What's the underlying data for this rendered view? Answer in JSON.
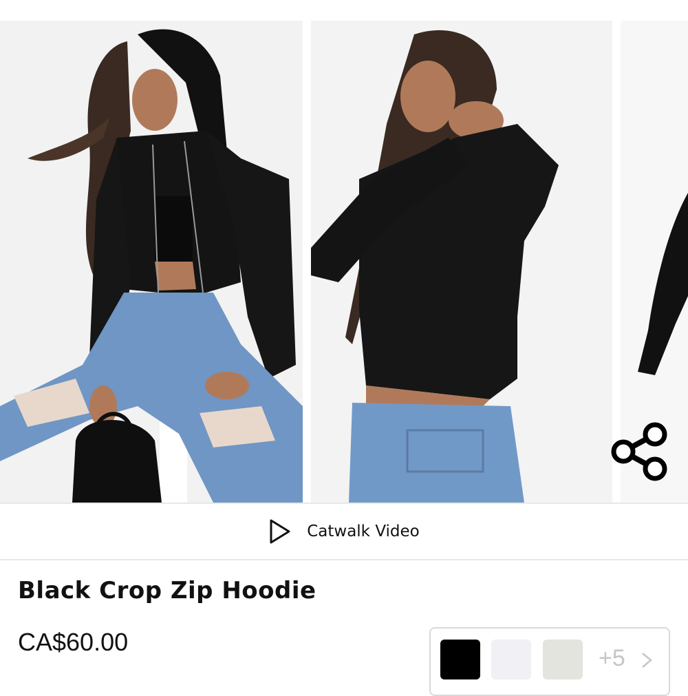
{
  "gallery": {
    "images": [
      {
        "name": "front view"
      },
      {
        "name": "side view"
      },
      {
        "name": "back view"
      }
    ],
    "share_icon": "share-icon"
  },
  "video": {
    "label": "Catwalk Video",
    "icon": "play-icon"
  },
  "product": {
    "title": "Black Crop Zip Hoodie",
    "price": "CA$60.00"
  },
  "swatches": {
    "colors": [
      "#000000",
      "#f0f0f5",
      "#e3e4de"
    ],
    "more_label": "+5",
    "more_icon": "chevron-right-icon"
  }
}
